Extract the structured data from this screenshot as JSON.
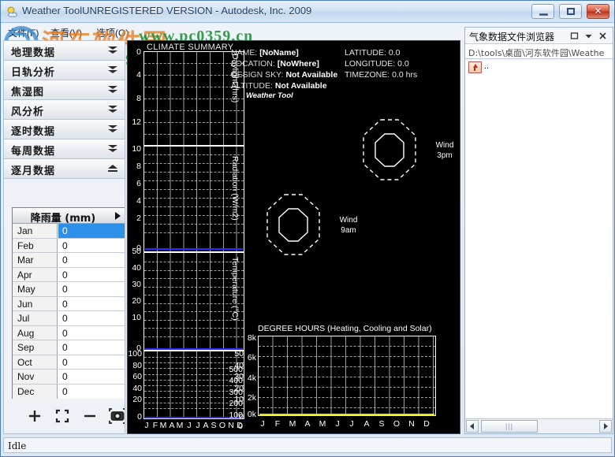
{
  "window": {
    "title": "Weather ToolUNREGISTERED VERSION -   Autodesk, Inc. 2009",
    "app_icon": "weather-tool-icon",
    "minimize_label": "–",
    "maximize_label": "□",
    "close_label": "✕"
  },
  "menu": {
    "items": [
      {
        "label": "文件(F)",
        "accel": "F"
      },
      {
        "label": "查看(V)",
        "accel": "V"
      },
      {
        "label": "选项(O)",
        "accel": "O"
      }
    ]
  },
  "watermark": {
    "cn": "河东软件园",
    "www": "www.pc0359.cn",
    "url": "www.pc0359.cn"
  },
  "sidebar": {
    "sections": [
      {
        "label": "地理数据",
        "state": "collapsed",
        "icon": "chevron-double-down-icon"
      },
      {
        "label": "日轨分析",
        "state": "collapsed",
        "icon": "chevron-double-down-icon"
      },
      {
        "label": "焦湿图",
        "state": "collapsed",
        "icon": "chevron-double-down-icon"
      },
      {
        "label": "风分析",
        "state": "collapsed",
        "icon": "chevron-double-down-icon"
      },
      {
        "label": "逐时数据",
        "state": "collapsed",
        "icon": "chevron-double-down-icon"
      },
      {
        "label": "每周数据",
        "state": "collapsed",
        "icon": "chevron-double-down-icon"
      },
      {
        "label": "逐月数据",
        "state": "expanded",
        "icon": "chevron-up-bar-icon"
      }
    ],
    "table": {
      "header": "降雨量 (mm)",
      "header_arrow": "play-icon",
      "selected_row": 0,
      "rows": [
        {
          "month": "Jan",
          "value": "0"
        },
        {
          "month": "Feb",
          "value": "0"
        },
        {
          "month": "Mar",
          "value": "0"
        },
        {
          "month": "Apr",
          "value": "0"
        },
        {
          "month": "May",
          "value": "0"
        },
        {
          "month": "Jun",
          "value": "0"
        },
        {
          "month": "Jul",
          "value": "0"
        },
        {
          "month": "Aug",
          "value": "0"
        },
        {
          "month": "Sep",
          "value": "0"
        },
        {
          "month": "Oct",
          "value": "0"
        },
        {
          "month": "Nov",
          "value": "0"
        },
        {
          "month": "Dec",
          "value": "0"
        }
      ]
    },
    "tools": [
      {
        "name": "zoom-in-button",
        "glyph": "+"
      },
      {
        "name": "fit-to-window-button",
        "glyph": "[ ]"
      },
      {
        "name": "zoom-out-button",
        "glyph": "–"
      },
      {
        "name": "snapshot-camera-button",
        "glyph": "camera"
      }
    ]
  },
  "canvas": {
    "title": "CLIMATE SUMMARY",
    "brand": "Weather Tool",
    "info_left": [
      {
        "key": "NAME:",
        "value": "[NoName]"
      },
      {
        "key": "LOCATION:",
        "value": "[NoWhere]"
      },
      {
        "key": "DESIGN SKY:",
        "value": "Not Available"
      },
      {
        "key": "ALTITUDE:",
        "value": "Not Available"
      }
    ],
    "info_right": [
      {
        "key": "LATITUDE:",
        "value": "0.0"
      },
      {
        "key": "LONGITUDE:",
        "value": "0.0"
      },
      {
        "key": "TIMEZONE:",
        "value": "0.0 hrs"
      }
    ],
    "wind_roses": [
      {
        "name": "wind-rose-9am",
        "line1": "Wind",
        "line2": "9am"
      },
      {
        "name": "wind-rose-3pm",
        "line1": "Wind",
        "line2": "3pm"
      }
    ]
  },
  "chart_data": [
    {
      "type": "line",
      "name": "daylight",
      "title": "CLIMATE SUMMARY",
      "ylabel": "Daylight (hrs)",
      "xlabel": "",
      "categories": [
        "J",
        "F",
        "M",
        "A",
        "M",
        "J",
        "J",
        "A",
        "S",
        "O",
        "N",
        "D"
      ],
      "values": [
        0,
        0,
        0,
        0,
        0,
        0,
        0,
        0,
        0,
        0,
        0,
        0
      ],
      "yticks": [
        "0",
        "4",
        "8",
        "12"
      ],
      "ylim": [
        12,
        0
      ],
      "grid": true
    },
    {
      "type": "line",
      "name": "radiation",
      "ylabel": "Radiation (W/m2)",
      "categories": [
        "J",
        "F",
        "M",
        "A",
        "M",
        "J",
        "J",
        "A",
        "S",
        "O",
        "N",
        "D"
      ],
      "values": [
        0,
        0,
        0,
        0,
        0,
        0,
        0,
        0,
        0,
        0,
        0,
        0
      ],
      "yticks": [
        "10",
        "8",
        "6",
        "4",
        "2",
        "0"
      ],
      "ylim": [
        0,
        10
      ],
      "grid": true,
      "zero_line_color": "#2b2bff"
    },
    {
      "type": "line",
      "name": "temperature",
      "ylabel": "Temperature (°C)",
      "categories": [
        "J",
        "F",
        "M",
        "A",
        "M",
        "J",
        "J",
        "A",
        "S",
        "O",
        "N",
        "D"
      ],
      "values": [
        0,
        0,
        0,
        0,
        0,
        0,
        0,
        0,
        0,
        0,
        0,
        0
      ],
      "yticks": [
        "50",
        "40",
        "30",
        "20",
        "10",
        "0"
      ],
      "ylim": [
        0,
        50
      ],
      "grid": true,
      "zero_line_color": "#2b2bff"
    },
    {
      "type": "line",
      "name": "humidity-rainfall",
      "categories": [
        "J",
        "F",
        "M",
        "A",
        "M",
        "J",
        "J",
        "A",
        "S",
        "O",
        "N",
        "D"
      ],
      "values": [
        0,
        0,
        0,
        0,
        0,
        0,
        0,
        0,
        0,
        0,
        0,
        0
      ],
      "yticks_left": [
        "100",
        "80",
        "60",
        "40",
        "20",
        "0"
      ],
      "yticks_mid": [
        "50",
        "40",
        "30",
        "20",
        "10",
        "0"
      ],
      "yticks_right": [
        "500",
        "400",
        "300",
        "200",
        "100",
        "0"
      ],
      "grid": true,
      "zero_line_color": "#2b2bff"
    },
    {
      "type": "line",
      "name": "degree-hours",
      "title": "DEGREE HOURS (Heating, Cooling and Solar)",
      "categories": [
        "J",
        "F",
        "M",
        "A",
        "M",
        "J",
        "J",
        "A",
        "S",
        "O",
        "N",
        "D"
      ],
      "values": [
        0,
        0,
        0,
        0,
        0,
        0,
        0,
        0,
        0,
        0,
        0,
        0
      ],
      "yticks": [
        "8k",
        "6k",
        "4k",
        "2k",
        "0k"
      ],
      "ylim": [
        0,
        8000
      ],
      "grid": true,
      "zero_line_color": "#e8e800"
    }
  ],
  "right_panel": {
    "title": "气象数据文件浏览器",
    "header_icons": [
      {
        "name": "restore-panel-icon",
        "glyph": "□"
      },
      {
        "name": "panel-menu-chevron-icon",
        "glyph": "▼"
      },
      {
        "name": "close-panel-icon",
        "glyph": "✕"
      }
    ],
    "path": "D:\\tools\\桌面\\河东软件园\\Weathe",
    "items": [
      {
        "name": "parent-folder-item",
        "icon": "folder-up-icon",
        "label": ".."
      }
    ],
    "scrollbar": {
      "left_arrow": "◄",
      "right_arrow": "►",
      "thumb": "|||"
    }
  },
  "statusbar": {
    "text": "Idle"
  }
}
